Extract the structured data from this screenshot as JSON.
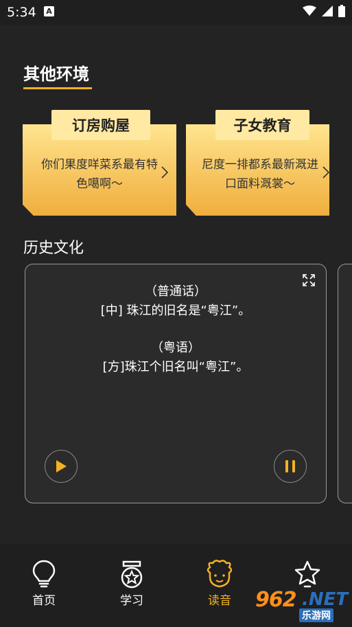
{
  "status_bar": {
    "time": "5:34",
    "notif": "A"
  },
  "section": {
    "title": "其他环境"
  },
  "cards": [
    {
      "tag": "订房购屋",
      "desc": "你们果度咩菜系最有特色噶啊～"
    },
    {
      "tag": "子女教育",
      "desc": "尼度一排都系最新溉进口面料溉裳～"
    }
  ],
  "history": {
    "title": "历史文化",
    "mandarin_tag": "（普通话）",
    "mandarin_text": "[中] 珠江的旧名是“粤江”。",
    "cantonese_tag": "（粤语）",
    "cantonese_text": "[方]珠江个旧名叫“粤江”。"
  },
  "nav": [
    {
      "label": "首页",
      "icon": "lightbulb-icon"
    },
    {
      "label": "学习",
      "icon": "medal-icon"
    },
    {
      "label": "读音",
      "icon": "sheep-icon"
    },
    {
      "label": "",
      "icon": "star-icon"
    }
  ],
  "watermark": {
    "main": "962",
    "net": ".NET",
    "sub": "乐游网"
  },
  "colors": {
    "accent": "#f4b223",
    "background": "#232323",
    "card_tab": "#ffe9a3"
  }
}
